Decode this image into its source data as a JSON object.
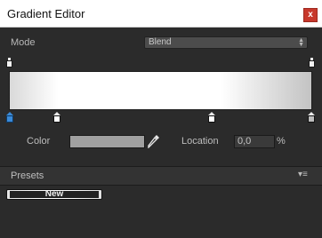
{
  "window": {
    "title": "Gradient Editor",
    "close_glyph": "x"
  },
  "mode": {
    "label": "Mode",
    "value": "Blend",
    "arrows_glyph": "▲▼"
  },
  "color": {
    "label": "Color",
    "swatch_hex": "#a0a0a0"
  },
  "location": {
    "label": "Location",
    "value": "0,0",
    "unit": "%"
  },
  "presets": {
    "label": "Presets",
    "menu_glyph": "▾≡",
    "new_label": "New"
  },
  "gradient_keys": {
    "alpha_positions": [
      0,
      1
    ],
    "color_positions": [
      0,
      0.16,
      0.68,
      1
    ],
    "selected_color_key": 0
  },
  "icons": {
    "eyedropper": "eyedropper-icon",
    "close": "close-icon",
    "menu": "menu-icon"
  }
}
